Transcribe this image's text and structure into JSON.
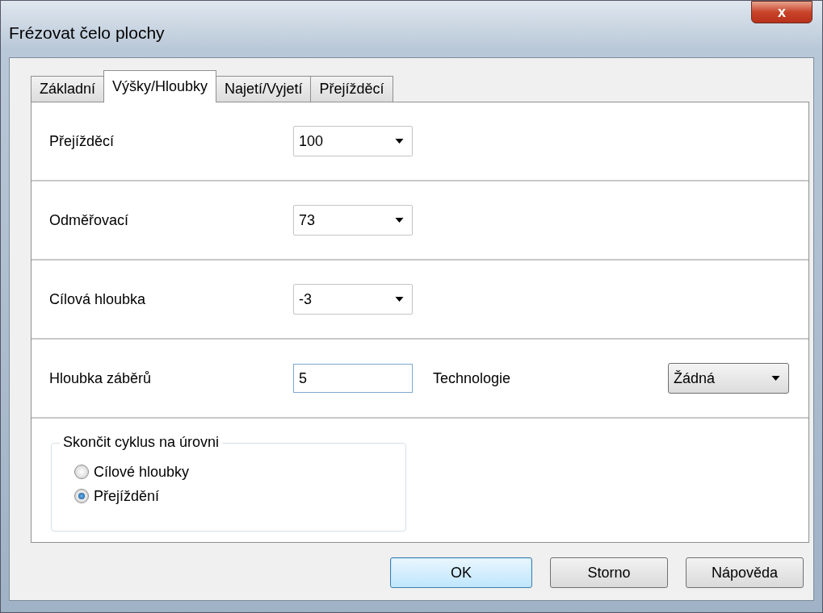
{
  "window": {
    "title": "Frézovat čelo plochy",
    "close": "x"
  },
  "tabs": [
    {
      "label": "Základní",
      "selected": false
    },
    {
      "label": "Výšky/Hloubky",
      "selected": true
    },
    {
      "label": "Najetí/Vyjetí",
      "selected": false
    },
    {
      "label": "Přejížděcí",
      "selected": false
    }
  ],
  "rows": [
    {
      "label": "Přejížděcí",
      "kind": "combo",
      "value": "100"
    },
    {
      "label": "Odměřovací",
      "kind": "combo",
      "value": "73"
    },
    {
      "label": "Cílová hloubka",
      "kind": "combo",
      "value": "-3"
    },
    {
      "label": "Hloubka záběrů",
      "kind": "text",
      "value": "5",
      "extra_label": "Technologie",
      "extra_value": "Žádná"
    }
  ],
  "group": {
    "title": "Skončit cyklus na úrovni",
    "options": [
      {
        "label": "Cílové hloubky",
        "selected": false
      },
      {
        "label": "Přejíždění",
        "selected": true
      }
    ]
  },
  "buttons": [
    {
      "label": "OK",
      "default": true
    },
    {
      "label": "Storno",
      "default": false
    },
    {
      "label": "Nápověda",
      "default": false
    }
  ]
}
